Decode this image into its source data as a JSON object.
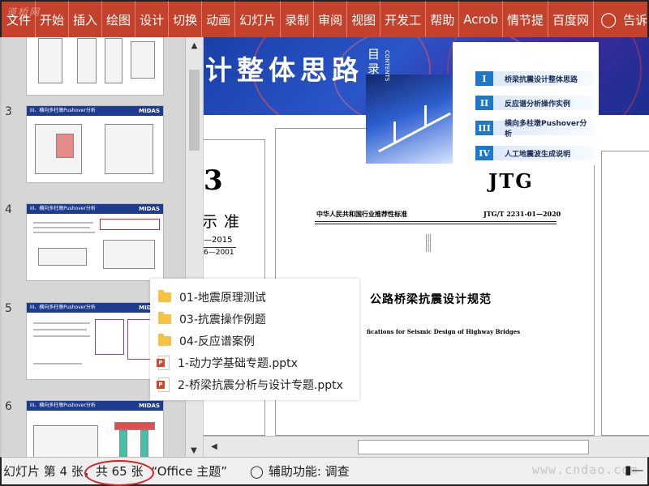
{
  "ribbon": {
    "tabs": [
      "文件",
      "开始",
      "插入",
      "绘图",
      "设计",
      "切换",
      "动画",
      "幻灯片",
      "录制",
      "审阅",
      "视图",
      "开发工",
      "帮助",
      "Acrob",
      "情节提",
      "百度网"
    ],
    "tell_me": "告诉",
    "watermark": "道桥网"
  },
  "thumbnails": [
    {
      "num": "",
      "title": ""
    },
    {
      "num": "3",
      "title": "III、横向多柱墩Pushover分析",
      "logo": "MIDAS"
    },
    {
      "num": "4",
      "title": "III、横向多柱墩Pushover分析",
      "logo": "MIDAS"
    },
    {
      "num": "5",
      "title": "III、横向多柱墩Pushover分析",
      "logo": "MIDAS"
    },
    {
      "num": "6",
      "title": "III、横向多柱墩Pushover分析",
      "logo": "MIDAS"
    }
  ],
  "slide": {
    "banner_title": "计整体思路",
    "toc_heading": "目录",
    "toc_contents": "CONTENTS",
    "toc_items": [
      {
        "num": "I",
        "label": "桥梁抗震设计整体思路"
      },
      {
        "num": "II",
        "label": "反应谱分析操作实例"
      },
      {
        "num": "III",
        "label": "横向多柱墩Pushover分析"
      },
      {
        "num": "IV",
        "label": "人工地震波生成说明"
      }
    ],
    "left_doc": {
      "big": "3",
      "std": "示准",
      "code1": "—2015",
      "code2": "6—2001"
    },
    "center_doc": {
      "jtg": "JTG",
      "org": "中华人民共和国行业推荐性标准",
      "std_no": "JTG/T 2231-01—2020",
      "marks": "|||\n|||\n|||",
      "title": "公路桥梁抗震设计规范",
      "en_title": "fications for Seismic Design of Highway Bridges"
    }
  },
  "file_list": [
    {
      "type": "folder",
      "name": "01-地震原理测试"
    },
    {
      "type": "folder",
      "name": "03-抗震操作例题"
    },
    {
      "type": "folder",
      "name": "04-反应谱案例"
    },
    {
      "type": "pptx",
      "name": "1-动力学基础专题.pptx"
    },
    {
      "type": "pptx",
      "name": "2-桥梁抗震分析与设计专题.pptx"
    }
  ],
  "status": {
    "slide_count": "幻灯片 第 4 张，共 65 张",
    "theme": "“Office 主题”",
    "accessibility": "辅助功能: 调查",
    "watermark": "www.cndao.com"
  },
  "colors": {
    "ribbon": "#c4422b",
    "toc_num": "#1e78c8",
    "highlight": "#d62020"
  }
}
